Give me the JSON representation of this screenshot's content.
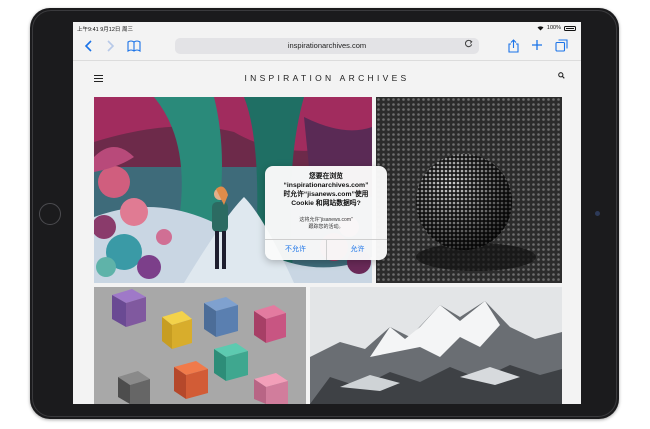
{
  "status_bar": {
    "time_date": "上午9:41  9月12日 周三",
    "battery_percent": "100%"
  },
  "browser": {
    "url": "inspirationarchives.com",
    "back_icon": "chevron-left-icon",
    "forward_icon": "chevron-right-icon",
    "bookmarks_icon": "book-icon",
    "reload_icon": "reload-icon",
    "share_icon": "share-icon",
    "add_icon": "plus-icon",
    "tabs_icon": "tabs-icon",
    "accent_color": "#1a73e8"
  },
  "site": {
    "title": "INSPIRATION ARCHIVES",
    "menu_icon": "hamburger-icon",
    "search_icon": "search-icon"
  },
  "dialog": {
    "title": "您要在浏览\n“inspirationarchives.com”\n时允许“jisanews.com”使用\nCookie 和网站数据吗?",
    "message": "这将允许“jisanews.com”\n跟踪您的活动。",
    "deny_label": "不允许",
    "allow_label": "允许"
  }
}
